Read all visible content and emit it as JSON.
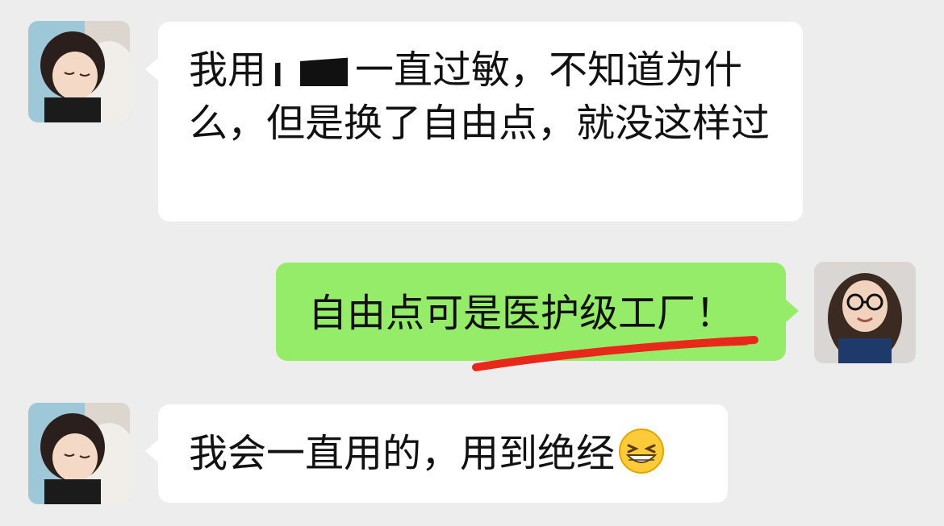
{
  "messages": [
    {
      "side": "left",
      "text_before": "我用",
      "text_after": "一直过敏，不知道为什么，但是换了自由点，就没这样过",
      "has_redaction": true
    },
    {
      "side": "right",
      "text": "自由点可是医护级工厂！",
      "annotation": "red-underline"
    },
    {
      "side": "left",
      "text": "我会一直用的，用到绝经",
      "emoji": "grinning-squinting-face"
    }
  ],
  "colors": {
    "background": "#ededed",
    "received_bubble": "#ffffff",
    "sent_bubble": "#95ec69",
    "underline": "#e8281a"
  }
}
